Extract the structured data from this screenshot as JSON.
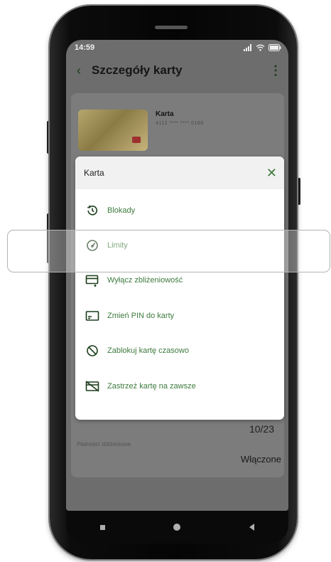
{
  "statusbar": {
    "time": "14:59"
  },
  "appbar": {
    "title": "Szczegóły karty"
  },
  "card": {
    "name": "Karta",
    "number_masked": "4112 **** **** 0166"
  },
  "background": {
    "value": "10/23",
    "contactless_label": "Płatności zbliżeniowe",
    "contactless_status": "Włączone"
  },
  "sheet": {
    "title": "Karta",
    "items": [
      {
        "label": "Blokady",
        "icon": "history-icon"
      },
      {
        "label": "Limity",
        "icon": "gauge-icon"
      },
      {
        "label": "Wyłącz zbliżeniowość",
        "icon": "card-contactless-off-icon"
      },
      {
        "label": "Zmień PIN do karty",
        "icon": "card-pin-icon"
      },
      {
        "label": "Zablokuj kartę czasowo",
        "icon": "block-icon"
      },
      {
        "label": "Zastrzeż kartę na zawsze",
        "icon": "card-cancel-icon"
      }
    ]
  },
  "colors": {
    "accent": "#3d7a3d",
    "overlay": "#6d6d6d"
  }
}
